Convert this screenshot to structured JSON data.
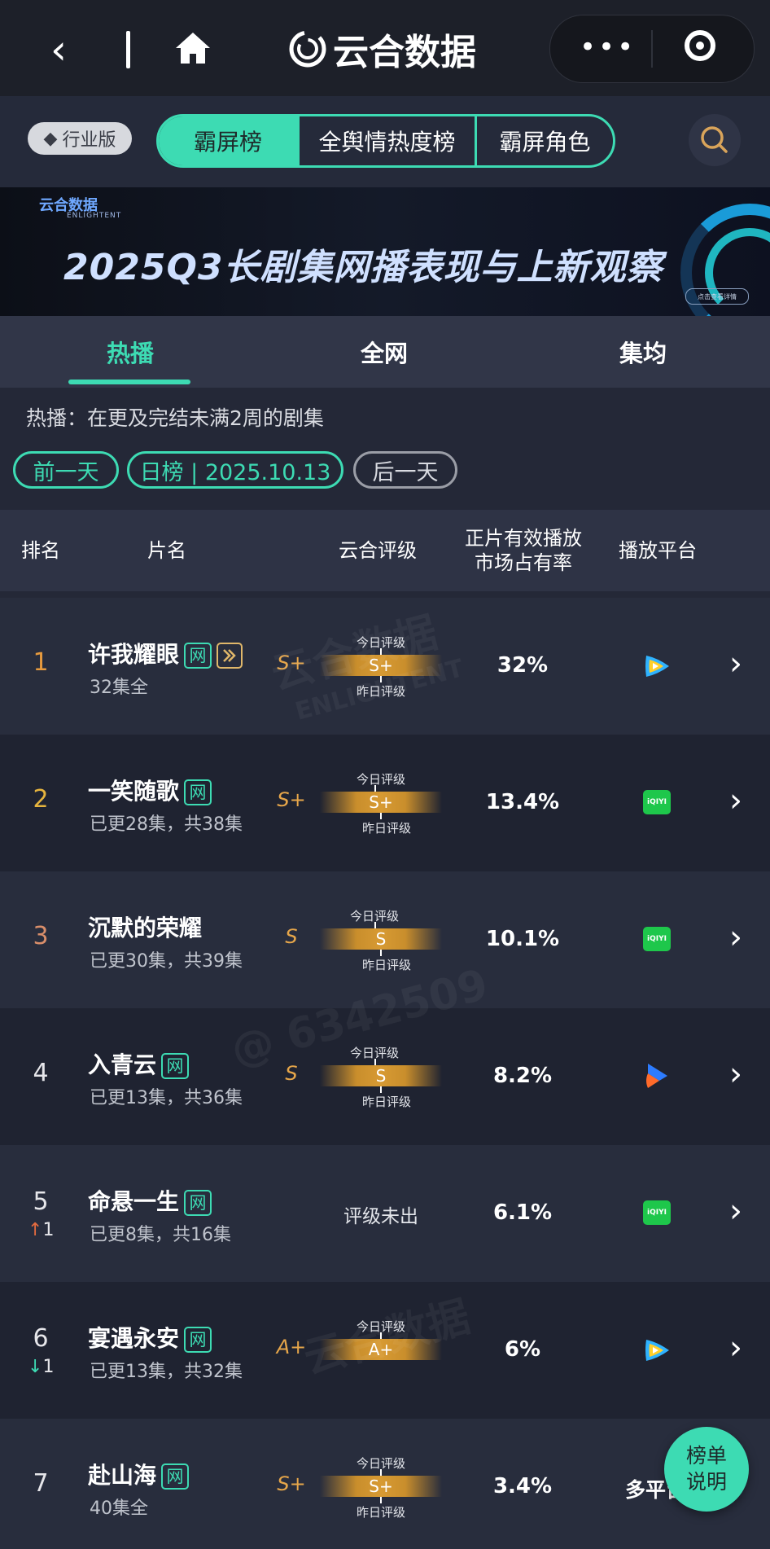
{
  "brand": {
    "name": "云合数据"
  },
  "edition_badge": "行业版",
  "main_tabs": [
    "霸屏榜",
    "全舆情热度榜",
    "霸屏角色"
  ],
  "banner": {
    "logo": "云合数据",
    "logo_sub": "ENLIGHTENT",
    "title": "2025Q3长剧集网播表现与上新观察",
    "button": "点击查看详情"
  },
  "sub_tabs": [
    "热播",
    "全网",
    "集均"
  ],
  "description": "热播：在更及完结未满2周的剧集",
  "date_nav": {
    "prev": "前一天",
    "current": "日榜 | 2025.10.13",
    "next": "后一天"
  },
  "table_headers": {
    "rank": "排名",
    "title": "片名",
    "rating": "云合评级",
    "share_line1": "正片有效播放",
    "share_line2": "市场占有率",
    "platform": "播放平台"
  },
  "rating_labels": {
    "today": "今日评级",
    "yesterday": "昨日评级",
    "none": "评级未出"
  },
  "rows": [
    {
      "rank": "1",
      "title": "许我耀眼",
      "episodes": "32集全",
      "yesterday": "S+",
      "today": "S+",
      "share": "32%",
      "platform": "tencent-video",
      "change": ""
    },
    {
      "rank": "2",
      "title": "一笑随歌",
      "episodes": "已更28集，共38集",
      "yesterday": "S+",
      "today": "S+",
      "share": "13.4%",
      "platform": "iqiyi",
      "change": ""
    },
    {
      "rank": "3",
      "title": "沉默的荣耀",
      "episodes": "已更30集，共39集",
      "yesterday": "S",
      "today": "S",
      "share": "10.1%",
      "platform": "iqiyi",
      "change": ""
    },
    {
      "rank": "4",
      "title": "入青云",
      "episodes": "已更13集，共36集",
      "yesterday": "S",
      "today": "S",
      "share": "8.2%",
      "platform": "youku",
      "change": ""
    },
    {
      "rank": "5",
      "title": "命悬一生",
      "episodes": "已更8集，共16集",
      "yesterday": "",
      "today": "",
      "share": "6.1%",
      "platform": "iqiyi",
      "change": "1"
    },
    {
      "rank": "6",
      "title": "宴遇永安",
      "episodes": "已更13集，共32集",
      "yesterday": "A+",
      "today": "A+",
      "share": "6%",
      "platform": "tencent-video",
      "change": "1"
    },
    {
      "rank": "7",
      "title": "赴山海",
      "episodes": "40集全",
      "yesterday": "S+",
      "today": "S+",
      "share": "3.4%",
      "platform_text": "多平台",
      "change": ""
    }
  ],
  "net_tag": "网",
  "iqiyi_label": "iQIYI",
  "fab": {
    "line1": "榜单",
    "line2": "说明"
  },
  "watermark": {
    "brand_cn": "云合数据",
    "brand_en": "ENLIGHTENT",
    "user": "@ 6342509"
  },
  "colors": {
    "accent": "#3ddbb3",
    "gold": "#d79a33",
    "background": "#242837"
  }
}
